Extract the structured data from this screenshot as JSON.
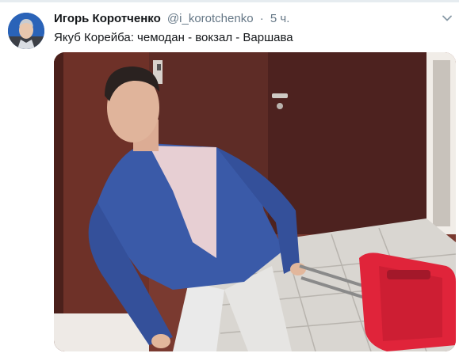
{
  "tweet": {
    "display_name": "Игорь Коротченко",
    "handle": "@i_korotchenko",
    "separator": "·",
    "time": "5 ч.",
    "text": "Якуб Корейба: чемодан - вокзал - Варшава",
    "menu_icon": "chevron-down-icon",
    "avatar_icon": "avatar-portrait",
    "media": {
      "type": "photo",
      "subject": "man in blue jacket with red suitcase"
    }
  },
  "colors": {
    "name": "#14171a",
    "secondary": "#657786",
    "divider": "#e6ecf0",
    "jacket": "#3a5aa8",
    "suitcase": "#e0243a",
    "door": "#5e2c26"
  }
}
